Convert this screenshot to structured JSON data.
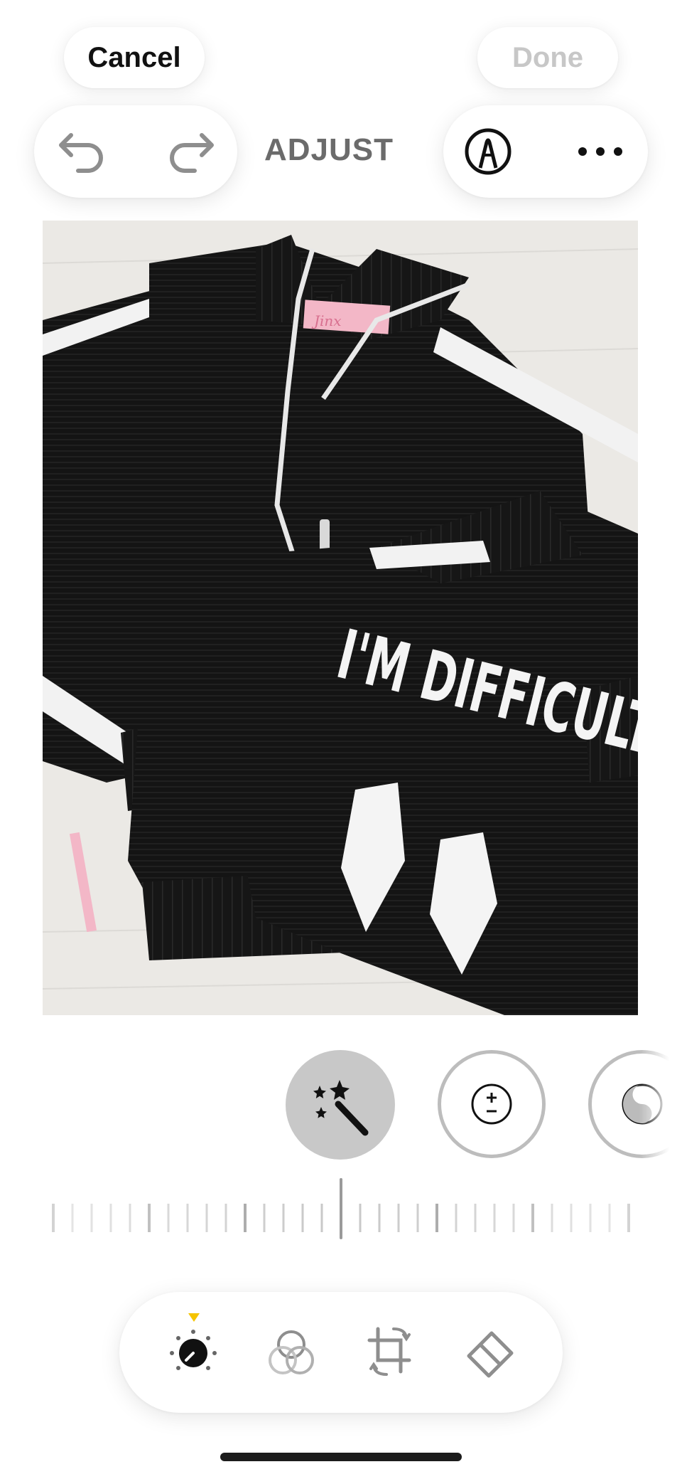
{
  "header": {
    "cancel_label": "Cancel",
    "done_label": "Done",
    "mode_title": "ADJUST"
  },
  "icons": {
    "undo": "undo-icon",
    "redo": "redo-icon",
    "markup": "markup-pen-icon",
    "more": "more-icon"
  },
  "photo": {
    "description_text": "I'M DIFFICULT",
    "label_text": "Jinx"
  },
  "adjustments": [
    {
      "name": "auto",
      "icon": "magic-wand-icon",
      "selected": true
    },
    {
      "name": "exposure",
      "icon": "plus-minus-icon",
      "selected": false
    },
    {
      "name": "brilliance",
      "icon": "yin-yang-icon",
      "selected": false
    }
  ],
  "slider": {
    "value": 0
  },
  "bottom_tabs": [
    {
      "name": "adjust",
      "icon": "adjust-dial-icon",
      "active": true
    },
    {
      "name": "filters",
      "icon": "filters-icon",
      "active": false
    },
    {
      "name": "crop",
      "icon": "crop-icon",
      "active": false
    },
    {
      "name": "clean-up",
      "icon": "eraser-icon",
      "active": false
    }
  ],
  "colors": {
    "accent_dot": "#f5c400",
    "done_disabled": "#c7c7c7"
  }
}
